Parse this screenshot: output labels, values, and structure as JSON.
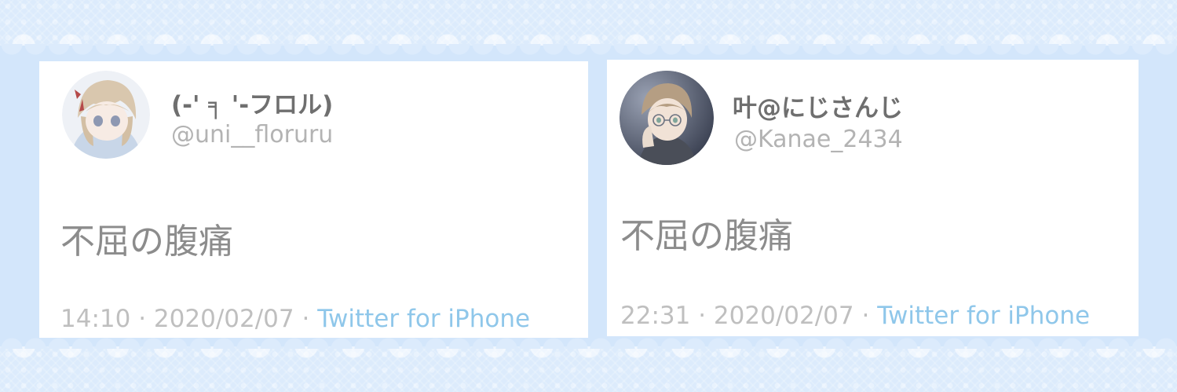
{
  "tweets": [
    {
      "display_name": "(-' ╕ '-フロル)",
      "handle": "@uni__floruru",
      "text": "不屈の腹痛",
      "time": "14:10",
      "separator": "·",
      "date": "2020/02/07",
      "source": "Twitter for iPhone"
    },
    {
      "display_name": "叶@にじさんじ",
      "handle": "@Kanae_2434",
      "text": "不屈の腹痛",
      "time": "22:31",
      "separator": "·",
      "date": "2020/02/07",
      "source": "Twitter for iPhone"
    }
  ],
  "colors": {
    "background": "#d3e6fb",
    "name": "#6f6f6f",
    "handle": "#b3b3b3",
    "body_text": "#8c8c8c",
    "meta": "#bfbfbf",
    "source_link": "#8fc7ea"
  }
}
